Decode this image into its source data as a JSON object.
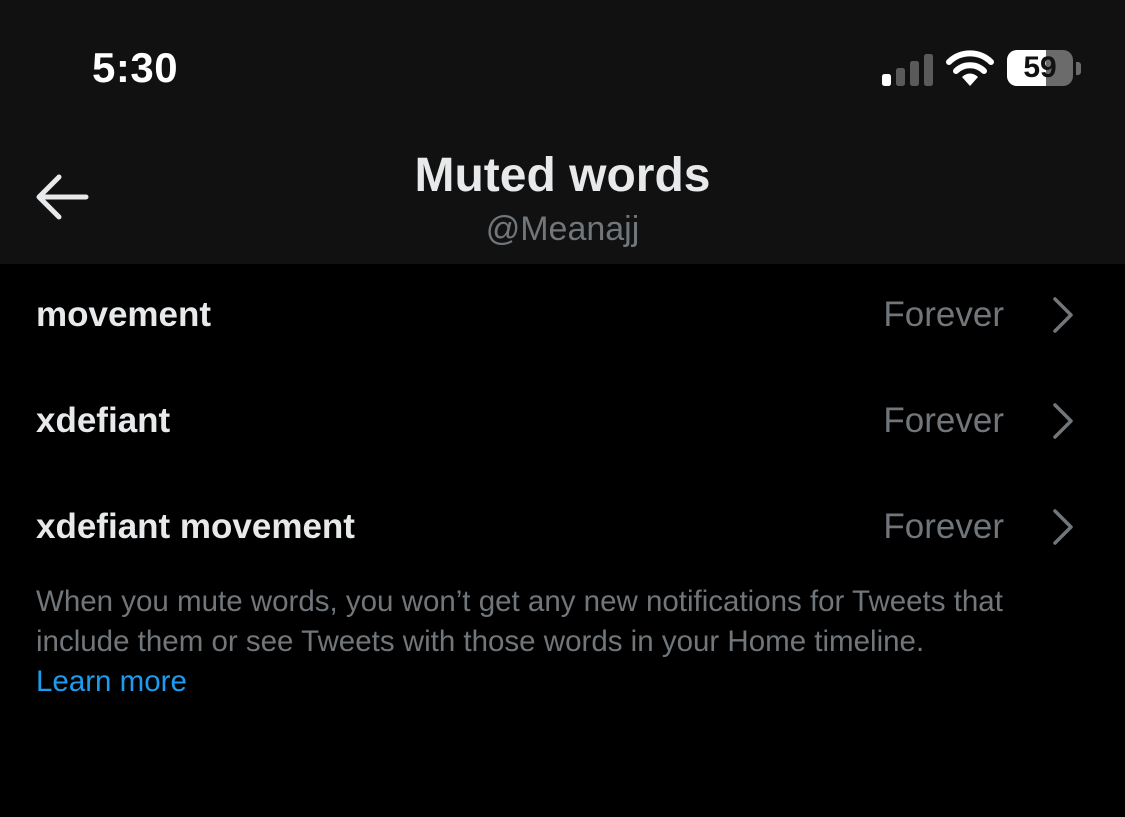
{
  "status_bar": {
    "time": "5:30",
    "battery_level": "59",
    "battery_fraction": 0.59
  },
  "header": {
    "title": "Muted words",
    "subtitle": "@Meanajj",
    "back_icon": "arrow-left-icon"
  },
  "muted_words": [
    {
      "word": "movement",
      "duration": "Forever"
    },
    {
      "word": "xdefiant",
      "duration": "Forever"
    },
    {
      "word": "xdefiant movement",
      "duration": "Forever"
    }
  ],
  "footer": {
    "description": "When you mute words, you won’t get any new notifications for Tweets that include them or see Tweets with those words in your Home timeline.",
    "learn_more": "Learn more"
  },
  "colors": {
    "background": "#000000",
    "header_background": "#111111",
    "primary_text": "#e7e9ea",
    "secondary_text": "#71767b",
    "link": "#1d9bf0"
  }
}
